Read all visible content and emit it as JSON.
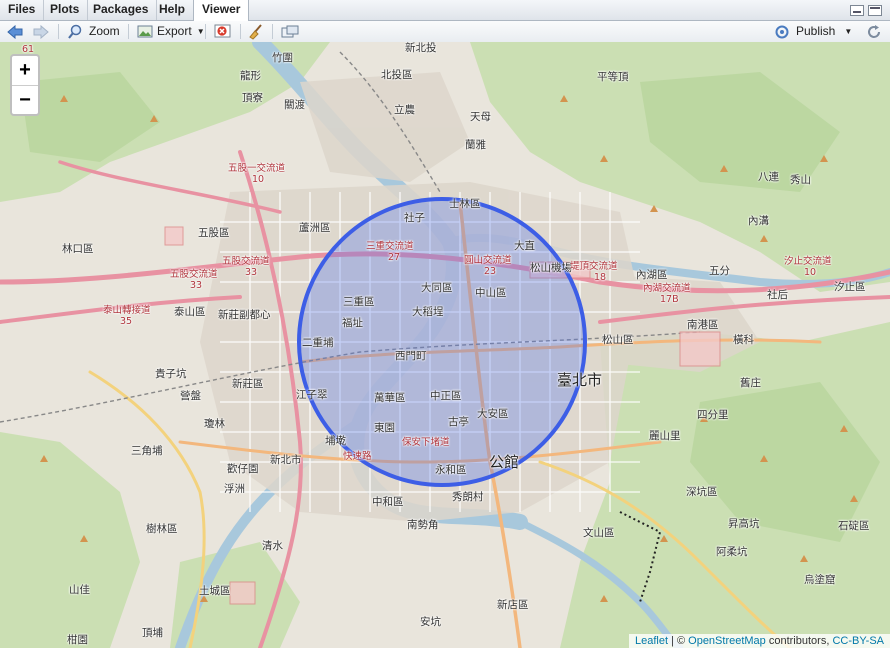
{
  "tabs": [
    {
      "label": "Files"
    },
    {
      "label": "Plots"
    },
    {
      "label": "Packages"
    },
    {
      "label": "Help"
    },
    {
      "label": "Viewer",
      "active": true
    }
  ],
  "toolbar": {
    "zoom_label": "Zoom",
    "export_label": "Export",
    "publish_label": "Publish"
  },
  "map": {
    "zoom_in": "+",
    "zoom_out": "−",
    "circle_stroke": "#3d5ee6",
    "circle_fill": "#4a6cf2",
    "labels": [
      "竹圍",
      "龍形",
      "頂寮",
      "關渡",
      "新北投",
      "北投區",
      "立農",
      "天母",
      "蘭雅",
      "平等頂",
      "五股一交流道",
      "10",
      "五股區",
      "蘆洲區",
      "社子",
      "士林區",
      "大直",
      "林口區",
      "三重交流道",
      "27",
      "圓山交流道",
      "23",
      "松山機場",
      "堤頂交流道",
      "18",
      "內湖區",
      "五分",
      "汐止交流道",
      "10",
      "汐止區",
      "八連",
      "秀山",
      "內溝",
      "五股交流道",
      "33",
      "五股交流道",
      "33",
      "泰山轉接道",
      "35",
      "泰山區",
      "新莊副都心",
      "三重區",
      "福址",
      "大同區",
      "大稻埕",
      "中山區",
      "內湖交流道",
      "17B",
      "社后",
      "南港區",
      "橫科",
      "二重埔",
      "西門町",
      "松山區",
      "臺北市",
      "貴子坑",
      "營盤",
      "新莊區",
      "江子翠",
      "萬華區",
      "中正區",
      "大安區",
      "舊庄",
      "四分里",
      "瓊林",
      "東園",
      "古亭",
      "三角埔",
      "埔墘",
      "快速路",
      "保安下堵道",
      "麗山里",
      "歡仔園",
      "新北市",
      "永和區",
      "公館",
      "浮洲",
      "深坑區",
      "中和區",
      "秀朗村",
      "樹林區",
      "南勢角",
      "文山區",
      "昇高坑",
      "石碇區",
      "清水",
      "阿柔坑",
      "土城區",
      "山佳",
      "新店區",
      "烏塗窟",
      "頂埔",
      "安坑",
      "柑園",
      "61"
    ],
    "attribution": {
      "leaflet": "Leaflet",
      "separator": " | © ",
      "osm": "OpenStreetMap",
      "contributors": " contributors, ",
      "license": "CC-BY-SA"
    }
  }
}
